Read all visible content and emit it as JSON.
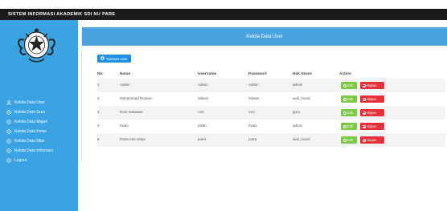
{
  "app": {
    "title": "SISTEM INFORMASI AKADEMIK SDI NU PARE"
  },
  "sidebar": {
    "items": [
      {
        "label": "Kelola Data User",
        "icon": "user-icon"
      },
      {
        "label": "Kelola Data Guru",
        "icon": "circle-icon"
      },
      {
        "label": "Kelola Data Mapel",
        "icon": "circle-icon"
      },
      {
        "label": "Kelola Data Kelas",
        "icon": "circle-icon"
      },
      {
        "label": "Kelola Data Nilai",
        "icon": "circle-icon"
      },
      {
        "label": "Kelola Data Informasi",
        "icon": "circle-icon"
      },
      {
        "label": "Logout",
        "icon": "circle-icon"
      }
    ]
  },
  "panel": {
    "title": "Kelola Data User",
    "add_button": "Tambah User",
    "columns": [
      "No.",
      "Nama",
      "Username",
      "Password",
      "Hak Akses",
      "Action"
    ],
    "edit_label": "Edit",
    "delete_label": "Hapus",
    "rows": [
      {
        "no": "1",
        "nama": "Admin",
        "username": "Admin",
        "password": "Admin",
        "hak": "admin"
      },
      {
        "no": "2",
        "nama": "Muhammad Ridwan",
        "username": "ridwan",
        "password": "ridwan",
        "hak": "wali_murid"
      },
      {
        "no": "3",
        "nama": "Roni Setiawan",
        "username": "roni",
        "password": "roni",
        "hak": "guru"
      },
      {
        "no": "4",
        "nama": "irwan",
        "username": "irwan",
        "password": "irwan",
        "hak": "admin"
      },
      {
        "no": "5",
        "nama": "Putra Arie setya",
        "username": "putra",
        "password": "putra",
        "hak": "wali_murid"
      }
    ]
  },
  "colors": {
    "topbar": "#1a1a1a",
    "sidebar": "#3aa3e3",
    "panel_header": "#4aa3e0",
    "add_button": "#1e90e8",
    "edit_button": "#7ac943",
    "delete_button": "#e6303a"
  }
}
